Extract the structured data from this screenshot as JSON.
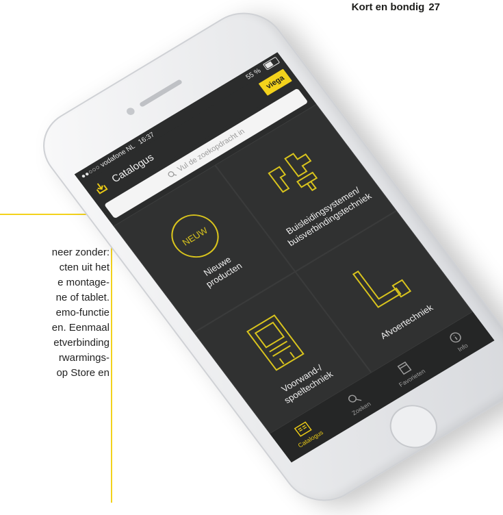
{
  "page_header": {
    "section": "Kort en bondig",
    "page_number": "27"
  },
  "body_text": [
    "neer zonder:",
    "cten uit het",
    "e montage-",
    "ne of tablet.",
    "emo-functie",
    "en. Eenmaal",
    "etverbinding",
    "rwarmings-",
    "op Store en"
  ],
  "phone": {
    "status_bar": {
      "carrier": "●●○○○ vodafone NL",
      "time": "16:37",
      "battery": "55 %"
    },
    "nav": {
      "title": "Catalogus",
      "logo": "viega"
    },
    "search": {
      "placeholder": "Vul de zoekopdracht in"
    },
    "tiles": [
      {
        "label_lines": [
          "Nieuwe",
          "producten"
        ],
        "badge": "NEUW",
        "icon": "new-badge-icon"
      },
      {
        "label_lines": [
          "Buisleidingsystemen/",
          "buisverbindingstechniek"
        ],
        "icon": "pipe-fittings-icon"
      },
      {
        "label_lines": [
          "Voorwand-/",
          "spoeltechniek"
        ],
        "icon": "pre-wall-element-icon"
      },
      {
        "label_lines": [
          "Afvoertechniek"
        ],
        "icon": "drain-icon"
      }
    ],
    "tabs": [
      {
        "label": "Catalogus",
        "icon": "catalogue-icon",
        "active": true
      },
      {
        "label": "Zoeken",
        "icon": "search-icon",
        "active": false
      },
      {
        "label": "Favorieten",
        "icon": "favorites-icon",
        "active": false
      },
      {
        "label": "Info",
        "icon": "info-icon",
        "active": false
      }
    ]
  },
  "colors": {
    "accent": "#f3d21c",
    "screen_bg": "#2f3030",
    "tile_accent": "#d9c41d"
  }
}
